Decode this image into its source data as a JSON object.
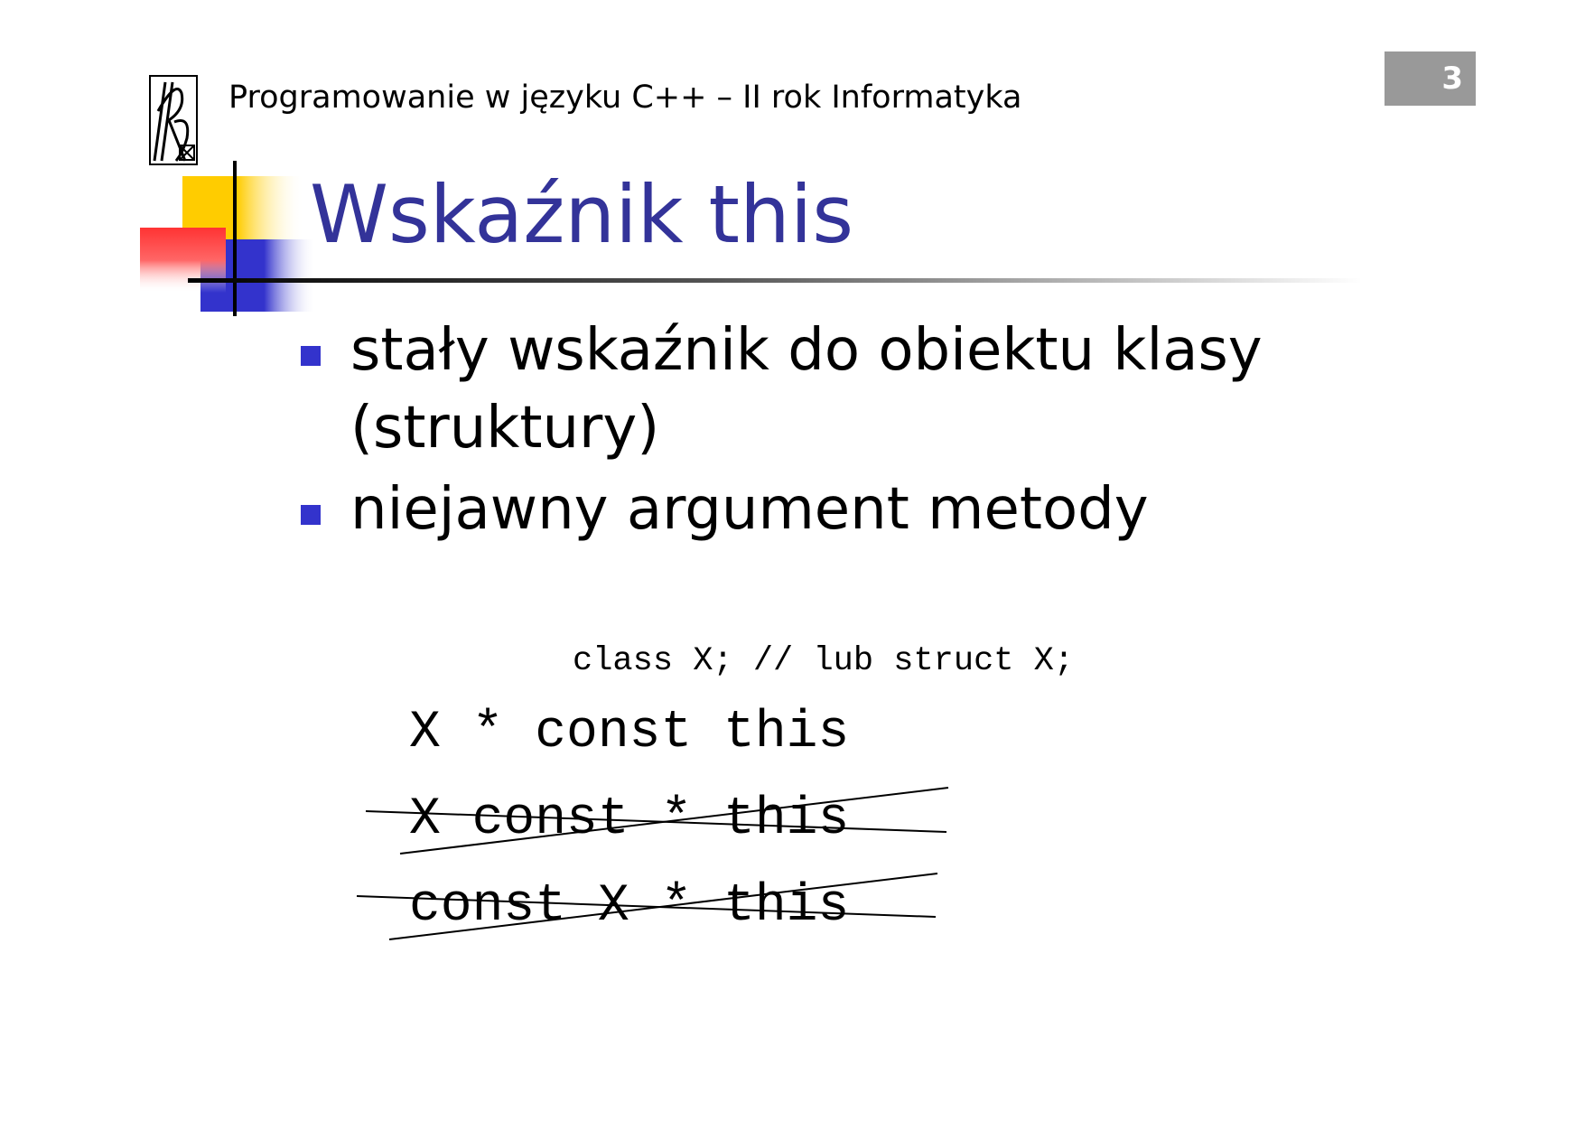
{
  "header": {
    "course_title": "Programowanie w języku C++ – II rok Informatyka",
    "page_number": "3"
  },
  "slide": {
    "title": "Wskaźnik this",
    "bullets": [
      "stały wskaźnik do obiektu klasy (struktury)",
      "niejawny argument metody"
    ],
    "code_declaration": "class X; // lub struct X;",
    "code_valid": "X * const this",
    "code_invalid_1": "X const * this",
    "code_invalid_2": "const X * this"
  },
  "colors": {
    "title": "#333399",
    "bullet_marker": "#3333cc",
    "page_badge": "#999999",
    "deco_yellow": "#ffcc00",
    "deco_red": "#ff3333",
    "deco_blue": "#3333cc"
  }
}
